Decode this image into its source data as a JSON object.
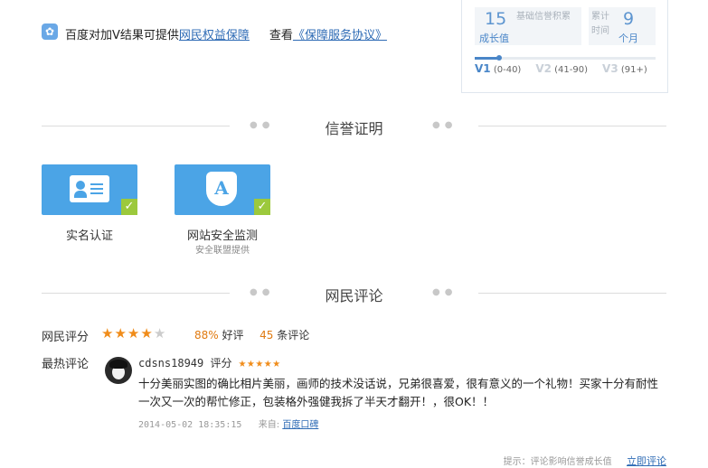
{
  "notice": {
    "icon": "paw-icon",
    "text": "百度对加V结果可提供",
    "link1": "网民权益保障",
    "view_label": "查看",
    "link2": "《保障服务协议》"
  },
  "growth": {
    "value": "15",
    "value_label": "成长值",
    "desc": "基础信誉积累",
    "days_label": "累计时间",
    "months": "9",
    "months_unit": "个月",
    "progress": 0.13,
    "levels": [
      {
        "badge": "V1",
        "range": "(0-40)"
      },
      {
        "badge": "V2",
        "range": "(41-90)"
      },
      {
        "badge": "V3",
        "range": "(91+)"
      }
    ]
  },
  "credit": {
    "title": "信誉证明",
    "items": [
      {
        "label": "实名认证",
        "sub": ""
      },
      {
        "label": "网站安全监测",
        "sub": "安全联盟提供"
      }
    ]
  },
  "reviews": {
    "title": "网民评论",
    "rating_label": "网民评分",
    "stars": 4.5,
    "good_pct": "88%",
    "good_label": "好评",
    "count": "45",
    "count_label": "条评论",
    "hot_label": "最热评论",
    "top": {
      "user": "cdsns18949",
      "score_label": "评分",
      "stars": 5,
      "text": "十分美丽实图的确比相片美丽，画师的技术没话说，兄弟很喜爱，很有意义的一个礼物！买家十分有耐性一次又一次的帮忙修正，包装格外强健我拆了半天才翻开！，很OK！！",
      "time": "2014-05-02 18:35:15",
      "source_label": "来自:",
      "source": "百度口碑"
    },
    "tip": "提示：评论影响信誉成长值",
    "comment_now": "立即评论"
  },
  "colors": {
    "accent": "#4ba4e6",
    "link": "#2e6bb5",
    "star": "#f08c1a",
    "check": "#9cc93c"
  }
}
